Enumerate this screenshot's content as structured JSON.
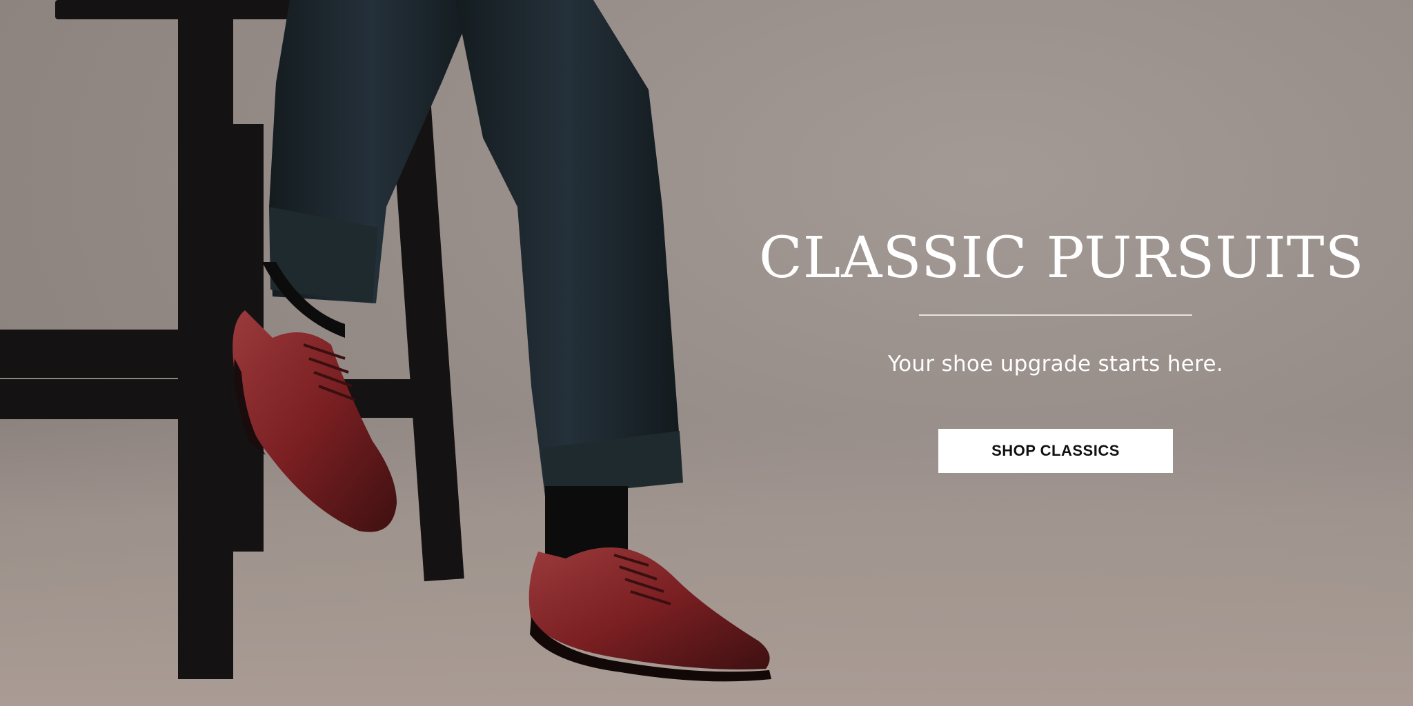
{
  "hero": {
    "headline": "CLASSIC PURSUITS",
    "subheadline": "Your shoe upgrade starts here.",
    "cta_label": "SHOP CLASSICS"
  },
  "colors": {
    "background": "#958b87",
    "text": "#ffffff",
    "cta_background": "#ffffff",
    "cta_text": "#111111",
    "shoe": "#7a1f22",
    "trousers": "#1c2629",
    "stool": "#141212"
  }
}
